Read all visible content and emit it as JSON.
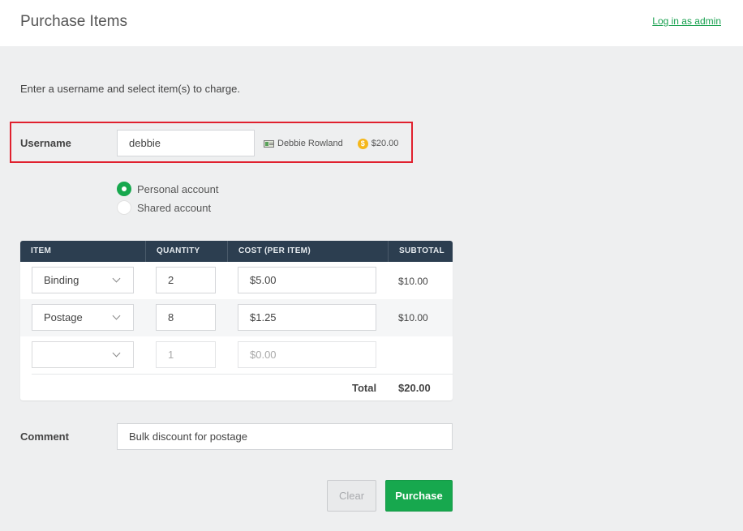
{
  "header": {
    "title": "Purchase Items",
    "admin_link": "Log in as admin"
  },
  "instructions": "Enter a username and select item(s) to charge.",
  "username": {
    "label": "Username",
    "value": "debbie",
    "full_name": "Debbie Rowland",
    "balance": "$20.00"
  },
  "account": {
    "options": [
      {
        "label": "Personal account",
        "selected": true
      },
      {
        "label": "Shared account",
        "selected": false
      }
    ]
  },
  "table": {
    "headers": [
      "ITEM",
      "QUANTITY",
      "COST (PER ITEM)",
      "SUBTOTAL"
    ],
    "rows": [
      {
        "item": "Binding",
        "quantity": "2",
        "cost": "$5.00",
        "subtotal": "$10.00"
      },
      {
        "item": "Postage",
        "quantity": "8",
        "cost": "$1.25",
        "subtotal": "$10.00"
      },
      {
        "item": "",
        "quantity": "1",
        "cost": "$0.00",
        "subtotal": ""
      }
    ],
    "total_label": "Total",
    "total_value": "$20.00"
  },
  "comment": {
    "label": "Comment",
    "value": "Bulk discount for postage"
  },
  "buttons": {
    "clear": "Clear",
    "purchase": "Purchase"
  },
  "colors": {
    "accent": "#17a84e",
    "table_header": "#2c3e50",
    "highlight_border": "#e0202e",
    "coin": "#f5b71a"
  },
  "icons": {
    "card": "card-icon",
    "coin": "coin-icon",
    "chevron": "chevron-down-icon"
  }
}
